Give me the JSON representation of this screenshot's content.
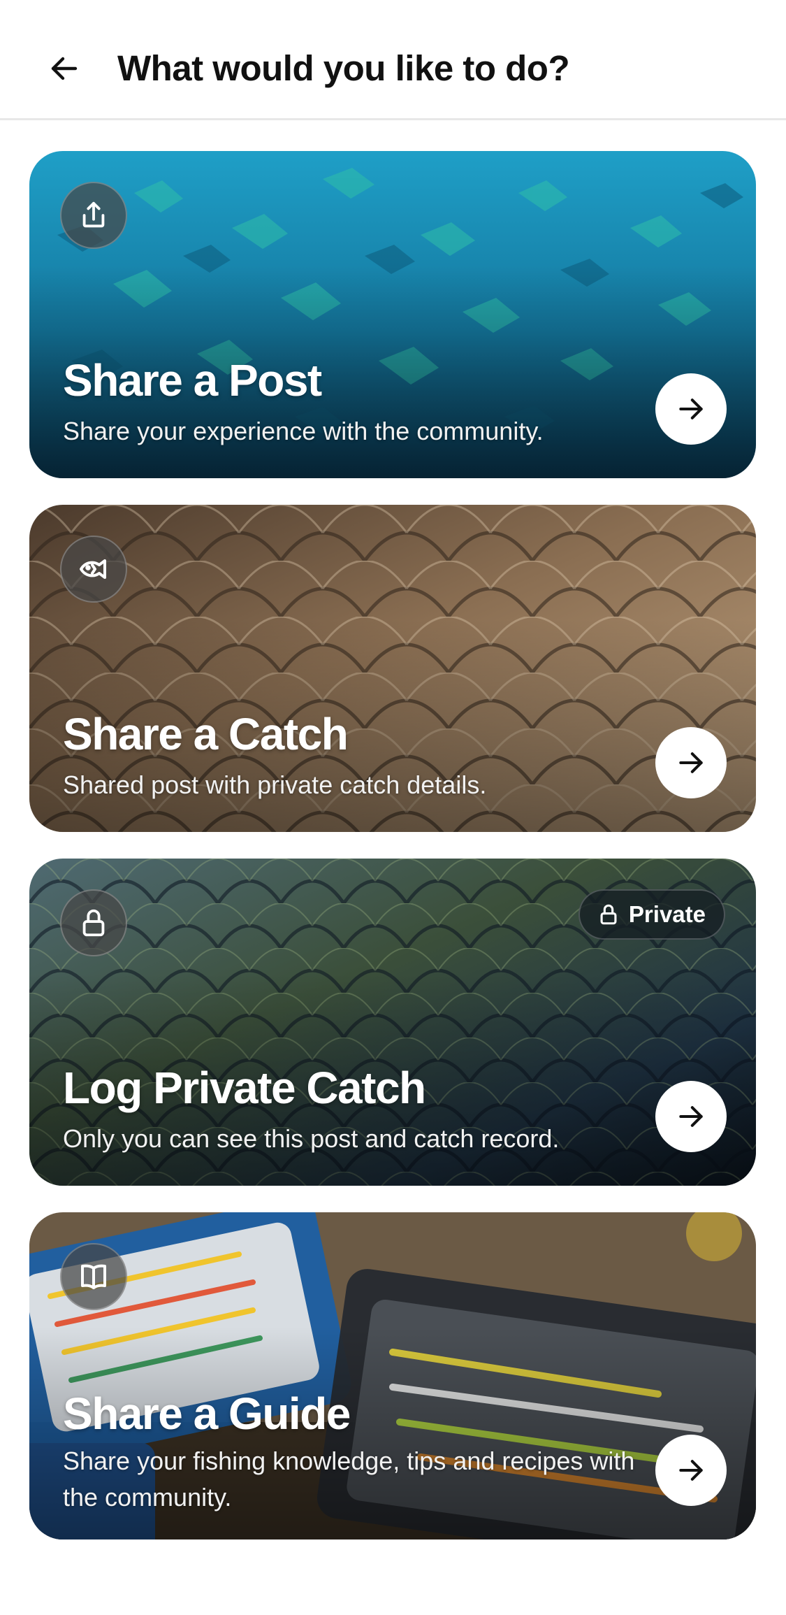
{
  "header": {
    "title": "What would you like to do?",
    "back_icon": "arrow-left-icon"
  },
  "options": [
    {
      "id": "share-post",
      "title": "Share a Post",
      "description": "Share your experience with the community.",
      "icon": "share-upload-icon",
      "action_icon": "arrow-right-icon"
    },
    {
      "id": "share-catch",
      "title": "Share a Catch",
      "description": "Shared post with private catch details.",
      "icon": "fish-icon",
      "action_icon": "arrow-right-icon"
    },
    {
      "id": "log-private-catch",
      "title": "Log Private Catch",
      "description": "Only you can see this post and catch record.",
      "icon": "lock-icon",
      "badge": "Private",
      "action_icon": "arrow-right-icon"
    },
    {
      "id": "share-guide",
      "title": "Share a Guide",
      "description": "Share your fishing knowledge, tips and recipes with the community.",
      "icon": "book-icon",
      "action_icon": "arrow-right-icon"
    }
  ]
}
